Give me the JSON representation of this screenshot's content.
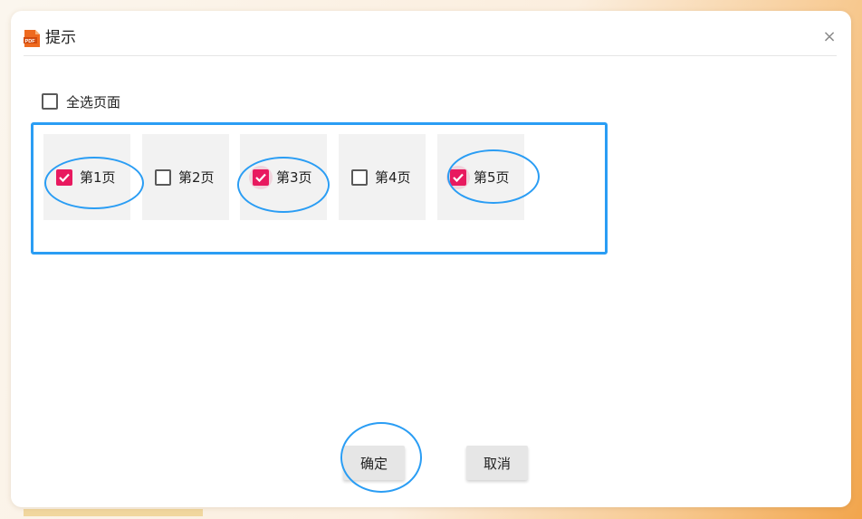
{
  "dialog": {
    "title": "提示",
    "close_symbol": "×",
    "icon": "pdf-app-icon"
  },
  "select_all": {
    "label": "全选页面",
    "checked": false
  },
  "pages": [
    {
      "label": "第1页",
      "checked": true
    },
    {
      "label": "第2页",
      "checked": false
    },
    {
      "label": "第3页",
      "checked": true
    },
    {
      "label": "第4页",
      "checked": false
    },
    {
      "label": "第5页",
      "checked": true
    }
  ],
  "buttons": {
    "confirm": "确定",
    "cancel": "取消"
  },
  "colors": {
    "checked": "#e8195f",
    "annotation": "#2a9df4",
    "card": "#f2f2f2",
    "button": "#e6e6e6"
  }
}
